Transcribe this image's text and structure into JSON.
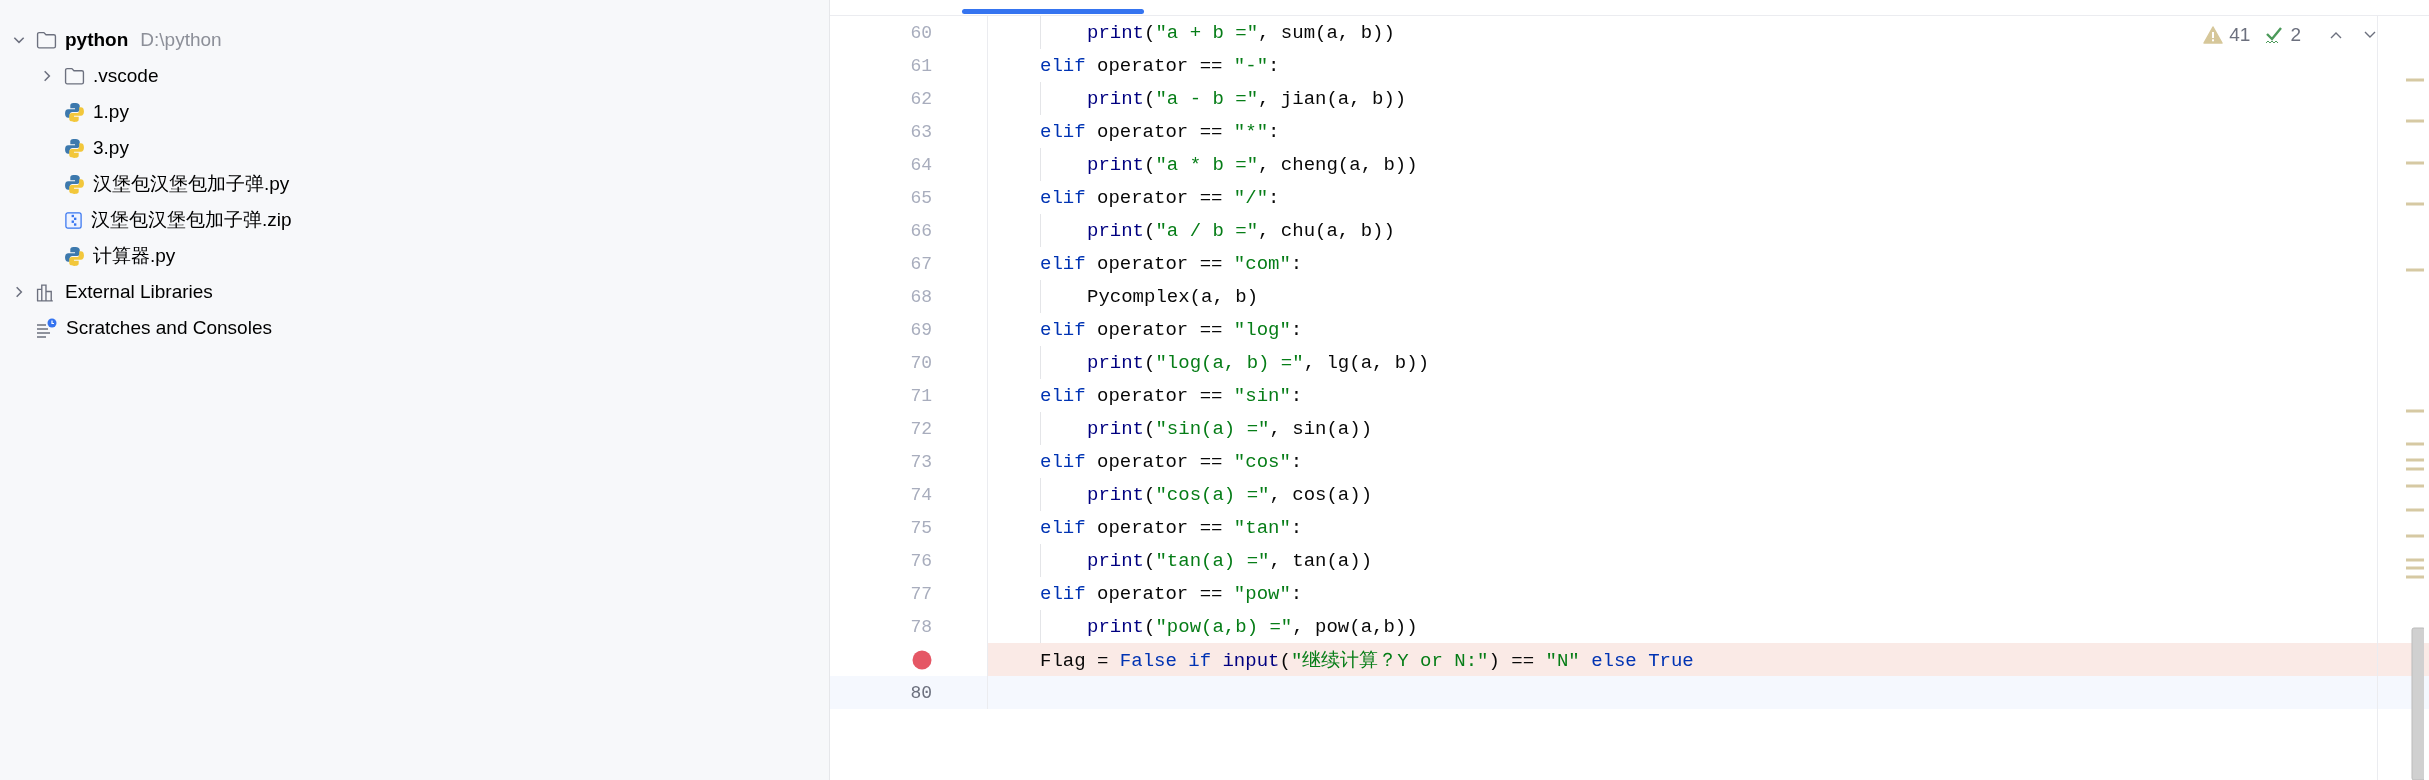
{
  "project_tree": [
    {
      "kind": "folder",
      "name": "python",
      "path": "D:\\python",
      "expanded": true,
      "children": [
        {
          "kind": "folder",
          "name": ".vscode",
          "expanded": false
        },
        {
          "kind": "python",
          "name": "1.py"
        },
        {
          "kind": "python",
          "name": "3.py"
        },
        {
          "kind": "python",
          "name": "汉堡包汉堡包加子弹.py"
        },
        {
          "kind": "zip",
          "name": "汉堡包汉堡包加子弹.zip"
        },
        {
          "kind": "python",
          "name": "计算器.py"
        }
      ]
    },
    {
      "kind": "library",
      "name": "External Libraries",
      "expanded": false
    },
    {
      "kind": "scratches",
      "name": "Scratches and Consoles"
    }
  ],
  "inspections": {
    "warnings": "41",
    "typos": "2"
  },
  "code_lines": [
    {
      "number": "60",
      "kind": "body",
      "breakpoint": false,
      "current": false,
      "tokens": [
        {
          "t": "print",
          "kind": "fn"
        },
        {
          "t": "(",
          "kind": "p"
        },
        {
          "t": "\"a + b =\"",
          "kind": "str"
        },
        {
          "t": ", sum(a, b))",
          "kind": "p"
        }
      ]
    },
    {
      "number": "61",
      "kind": "block",
      "breakpoint": false,
      "current": false,
      "tokens": [
        {
          "t": "elif",
          "kind": "kw"
        },
        {
          "t": " operator == ",
          "kind": "p"
        },
        {
          "t": "\"-\"",
          "kind": "str"
        },
        {
          "t": ":",
          "kind": "p"
        }
      ]
    },
    {
      "number": "62",
      "kind": "body",
      "breakpoint": false,
      "current": false,
      "tokens": [
        {
          "t": "print",
          "kind": "fn"
        },
        {
          "t": "(",
          "kind": "p"
        },
        {
          "t": "\"a - b =\"",
          "kind": "str"
        },
        {
          "t": ", jian(a, b))",
          "kind": "p"
        }
      ]
    },
    {
      "number": "63",
      "kind": "block",
      "breakpoint": false,
      "current": false,
      "tokens": [
        {
          "t": "elif",
          "kind": "kw"
        },
        {
          "t": " operator == ",
          "kind": "p"
        },
        {
          "t": "\"*\"",
          "kind": "str"
        },
        {
          "t": ":",
          "kind": "p"
        }
      ]
    },
    {
      "number": "64",
      "kind": "body",
      "breakpoint": false,
      "current": false,
      "tokens": [
        {
          "t": "print",
          "kind": "fn"
        },
        {
          "t": "(",
          "kind": "p"
        },
        {
          "t": "\"a * b =\"",
          "kind": "str"
        },
        {
          "t": ", cheng(a, b))",
          "kind": "p"
        }
      ]
    },
    {
      "number": "65",
      "kind": "block",
      "breakpoint": false,
      "current": false,
      "tokens": [
        {
          "t": "elif",
          "kind": "kw"
        },
        {
          "t": " operator == ",
          "kind": "p"
        },
        {
          "t": "\"/\"",
          "kind": "str"
        },
        {
          "t": ":",
          "kind": "p"
        }
      ]
    },
    {
      "number": "66",
      "kind": "body",
      "breakpoint": false,
      "current": false,
      "tokens": [
        {
          "t": "print",
          "kind": "fn"
        },
        {
          "t": "(",
          "kind": "p"
        },
        {
          "t": "\"a / b =\"",
          "kind": "str"
        },
        {
          "t": ", chu(a, b))",
          "kind": "p"
        }
      ]
    },
    {
      "number": "67",
      "kind": "block",
      "breakpoint": false,
      "current": false,
      "tokens": [
        {
          "t": "elif",
          "kind": "kw"
        },
        {
          "t": " operator == ",
          "kind": "p"
        },
        {
          "t": "\"com\"",
          "kind": "str"
        },
        {
          "t": ":",
          "kind": "p"
        }
      ]
    },
    {
      "number": "68",
      "kind": "body",
      "breakpoint": false,
      "current": false,
      "tokens": [
        {
          "t": "Pycomplex(a, b)",
          "kind": "p"
        }
      ]
    },
    {
      "number": "69",
      "kind": "block",
      "breakpoint": false,
      "current": false,
      "tokens": [
        {
          "t": "elif",
          "kind": "kw"
        },
        {
          "t": " operator == ",
          "kind": "p"
        },
        {
          "t": "\"log\"",
          "kind": "str"
        },
        {
          "t": ":",
          "kind": "p"
        }
      ]
    },
    {
      "number": "70",
      "kind": "body",
      "breakpoint": false,
      "current": false,
      "tokens": [
        {
          "t": "print",
          "kind": "fn"
        },
        {
          "t": "(",
          "kind": "p"
        },
        {
          "t": "\"log(a, b) =\"",
          "kind": "str"
        },
        {
          "t": ", lg(a, b))",
          "kind": "p"
        }
      ]
    },
    {
      "number": "71",
      "kind": "block",
      "breakpoint": false,
      "current": false,
      "tokens": [
        {
          "t": "elif",
          "kind": "kw"
        },
        {
          "t": " operator == ",
          "kind": "p"
        },
        {
          "t": "\"sin\"",
          "kind": "str"
        },
        {
          "t": ":",
          "kind": "p"
        }
      ]
    },
    {
      "number": "72",
      "kind": "body",
      "breakpoint": false,
      "current": false,
      "tokens": [
        {
          "t": "print",
          "kind": "fn"
        },
        {
          "t": "(",
          "kind": "p"
        },
        {
          "t": "\"sin(a) =\"",
          "kind": "str"
        },
        {
          "t": ", sin(a))",
          "kind": "p"
        }
      ]
    },
    {
      "number": "73",
      "kind": "block",
      "breakpoint": false,
      "current": false,
      "tokens": [
        {
          "t": "elif",
          "kind": "kw"
        },
        {
          "t": " operator == ",
          "kind": "p"
        },
        {
          "t": "\"cos\"",
          "kind": "str"
        },
        {
          "t": ":",
          "kind": "p"
        }
      ]
    },
    {
      "number": "74",
      "kind": "body",
      "breakpoint": false,
      "current": false,
      "tokens": [
        {
          "t": "print",
          "kind": "fn"
        },
        {
          "t": "(",
          "kind": "p"
        },
        {
          "t": "\"cos(a) =\"",
          "kind": "str"
        },
        {
          "t": ", cos(a))",
          "kind": "p"
        }
      ]
    },
    {
      "number": "75",
      "kind": "block",
      "breakpoint": false,
      "current": false,
      "tokens": [
        {
          "t": "elif",
          "kind": "kw"
        },
        {
          "t": " operator == ",
          "kind": "p"
        },
        {
          "t": "\"tan\"",
          "kind": "str"
        },
        {
          "t": ":",
          "kind": "p"
        }
      ]
    },
    {
      "number": "76",
      "kind": "body",
      "breakpoint": false,
      "current": false,
      "tokens": [
        {
          "t": "print",
          "kind": "fn"
        },
        {
          "t": "(",
          "kind": "p"
        },
        {
          "t": "\"tan(a) =\"",
          "kind": "str"
        },
        {
          "t": ", tan(a))",
          "kind": "p"
        }
      ]
    },
    {
      "number": "77",
      "kind": "block",
      "breakpoint": false,
      "current": false,
      "tokens": [
        {
          "t": "elif",
          "kind": "kw"
        },
        {
          "t": " operator == ",
          "kind": "p"
        },
        {
          "t": "\"pow\"",
          "kind": "str"
        },
        {
          "t": ":",
          "kind": "p"
        }
      ]
    },
    {
      "number": "78",
      "kind": "body",
      "breakpoint": false,
      "current": false,
      "tokens": [
        {
          "t": "print",
          "kind": "fn"
        },
        {
          "t": "(",
          "kind": "p"
        },
        {
          "t": "\"pow(a,b) =\"",
          "kind": "str"
        },
        {
          "t": ", pow(a,b))",
          "kind": "p"
        }
      ]
    },
    {
      "kind": "block",
      "breakpoint": true,
      "current": false,
      "tokens": [
        {
          "t": "Flag = ",
          "kind": "p"
        },
        {
          "t": "False if",
          "kind": "kw"
        },
        {
          "t": " input",
          "kind": "fn"
        },
        {
          "t": "(",
          "kind": "p"
        },
        {
          "t": "\"继续计算？Y or N:\"",
          "kind": "str"
        },
        {
          "t": ") == ",
          "kind": "p"
        },
        {
          "t": "\"N\"",
          "kind": "str"
        },
        {
          "t": " else True",
          "kind": "kw"
        }
      ]
    },
    {
      "number": "80",
      "kind": "block",
      "breakpoint": false,
      "current": true
    }
  ]
}
